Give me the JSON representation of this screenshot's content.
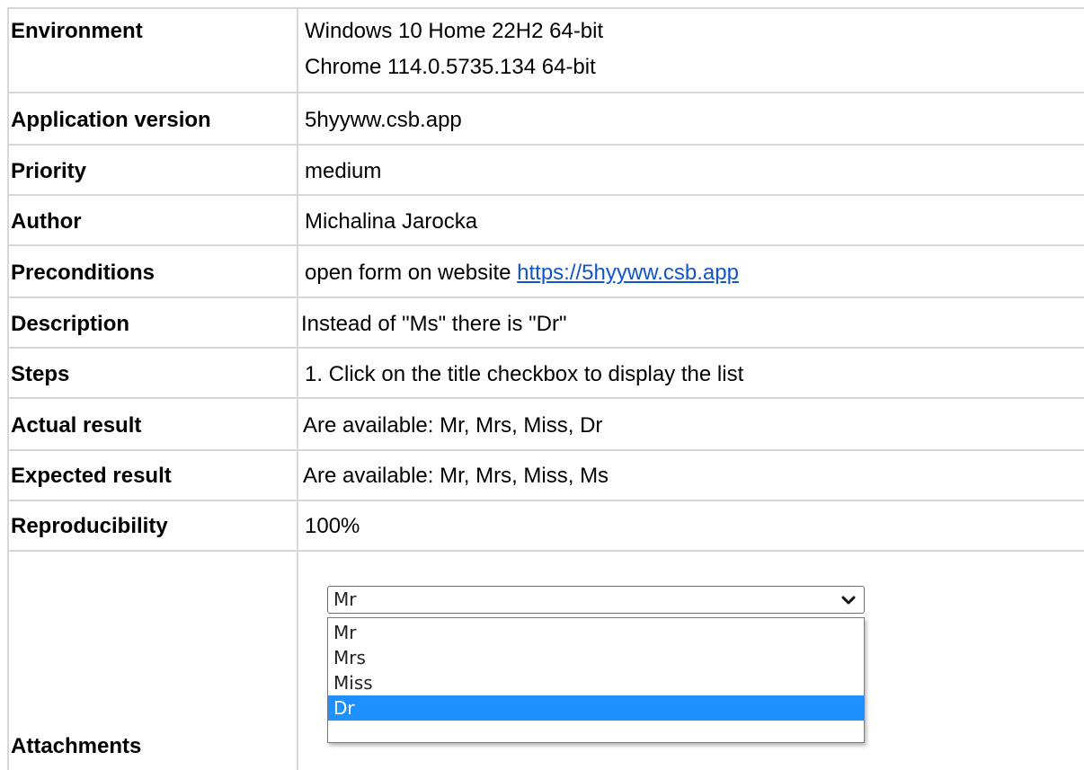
{
  "rows": [
    {
      "label": "Environment",
      "value_lines": [
        "Windows 10 Home 22H2 64-bit",
        "Chrome 114.0.5735.134 64-bit"
      ]
    },
    {
      "label": "Application version",
      "value": "5hyyww.csb.app"
    },
    {
      "label": "Priority",
      "value": "medium"
    },
    {
      "label": "Author",
      "value": "Michalina Jarocka"
    },
    {
      "label": "Preconditions",
      "value": "open form on website ",
      "link": "https://5hyyww.csb.app"
    },
    {
      "label": "Description",
      "value": "Instead of \"Ms\" there is \"Dr\""
    },
    {
      "label": "Steps",
      "value": "1. Click on the title checkbox to display the list"
    },
    {
      "label": "Actual result",
      "value": "Are available: Mr, Mrs, Miss, Dr"
    },
    {
      "label": "Expected result",
      "value": "Are available: Mr, Mrs, Miss, Ms"
    },
    {
      "label": "Reproducibility",
      "value": "100%"
    },
    {
      "label": "Attachments"
    }
  ],
  "attachment": {
    "select_value": "Mr",
    "options": [
      "Mr",
      "Mrs",
      "Miss",
      "Dr"
    ],
    "highlighted_option": "Dr",
    "icon": "chevron-down-icon"
  },
  "colors": {
    "link": "#1155cc",
    "grid": "#d8d8d8",
    "highlight": "#1e90ff"
  }
}
